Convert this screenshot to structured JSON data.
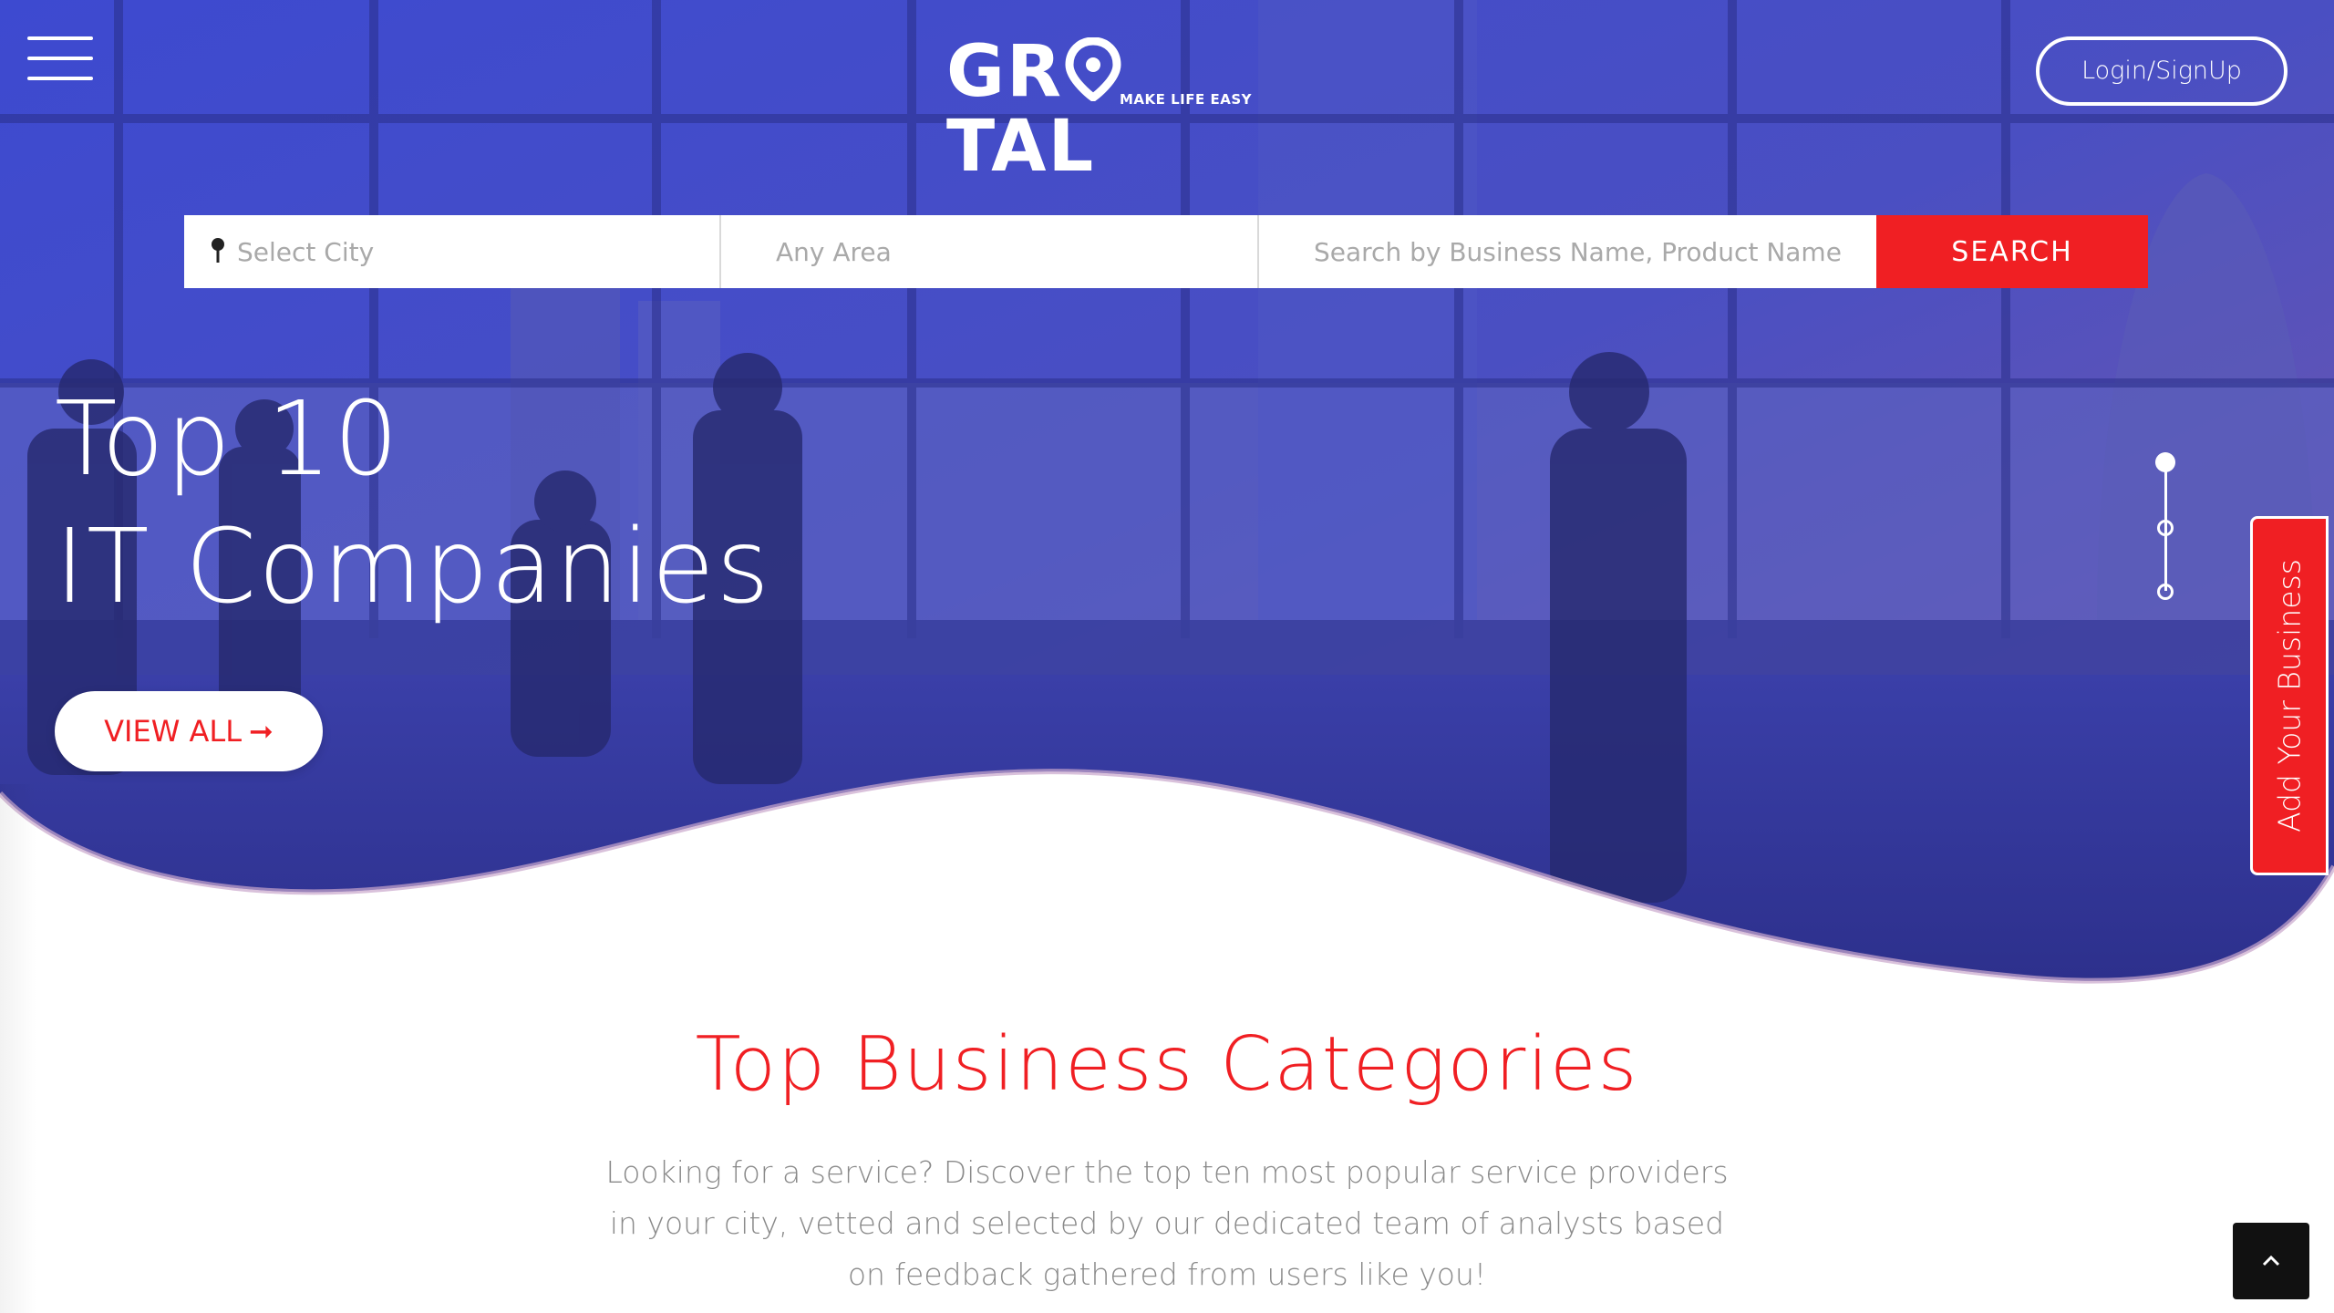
{
  "header": {
    "logo_text_left": "GR",
    "logo_text_right": "TAL",
    "logo_tagline": "MAKE LIFE EASY",
    "login_label": "Login/SignUp",
    "menu_icon": "hamburger-icon"
  },
  "search": {
    "city_placeholder": "Select City",
    "area_placeholder": "Any Area",
    "query_placeholder": "Search by Business Name, Product Name",
    "button_label": "SEARCH",
    "city_icon": "map-pin-icon"
  },
  "hero": {
    "line1": "Top 10",
    "line2": "IT Companies",
    "cta_label": "VIEW ALL",
    "cta_arrow": "➞",
    "slide_count": 3,
    "active_slide": 1,
    "side_tab_label": "Add Your Business"
  },
  "categories": {
    "title": "Top Business Categories",
    "description": "Looking for a service? Discover the top ten most popular service providers in your city, vetted and selected by our dedicated team of analysts based on feedback gathered from users like you!"
  },
  "colors": {
    "accent": "#f01f23",
    "hero_overlay_start": "#3b46c9",
    "hero_overlay_end": "#6d5bb8",
    "text_muted": "#8a8a8a"
  }
}
